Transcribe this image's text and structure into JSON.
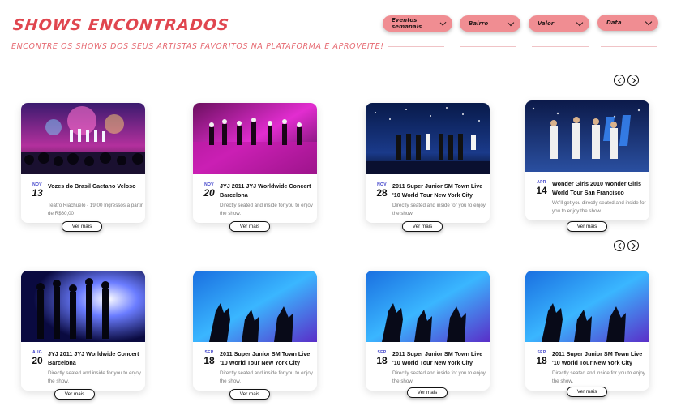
{
  "header": {
    "title": "Shows encontrados",
    "subtitle": "Encontre os shows dos seus artistas favoritos na plataforma e aproveite!"
  },
  "filters": [
    {
      "label": "Eventos semanais",
      "icon": "chevron-down-icon"
    },
    {
      "label": "Bairro",
      "icon": "chevron-down-icon"
    },
    {
      "label": "Valor",
      "icon": "chevron-down-icon"
    },
    {
      "label": "Data",
      "icon": "chevron-down-icon"
    }
  ],
  "carousel_nav": {
    "prev_icon": "chevron-left-icon",
    "next_icon": "chevron-right-icon"
  },
  "cards": [
    {
      "month": "NOV",
      "day": "13",
      "name": "Vozes do Brasil Caetano Veloso",
      "info": "Teatro Riachuelo - 19:00 Ingressos a partir de R$60,00",
      "button": "Ver mais",
      "image": "concert-stage-photo"
    },
    {
      "month": "NOV",
      "day": "20",
      "name": "JYJ 2011 JYJ Worldwide Concert Barcelona",
      "info": "Directly seated and inside for you to enjoy the show.",
      "button": "Ver mais",
      "image": "concert-stage-photo"
    },
    {
      "month": "NOV",
      "day": "28",
      "name": "2011 Super Junior SM Town Live '10 World Tour New York City",
      "info": "Directly seated and inside for you to enjoy the show.",
      "button": "Ver mais",
      "image": "concert-stage-photo"
    },
    {
      "month": "APR",
      "day": "14",
      "name": "Wonder Girls 2010 Wonder Girls World Tour San Francisco",
      "info": "We'll get you directly seated and inside for you to enjoy the show.",
      "button": "Ver mais",
      "image": "concert-stage-photo"
    },
    {
      "month": "AUG",
      "day": "20",
      "name": "JYJ 2011 JYJ Worldwide Concert Barcelona",
      "info": "Directly seated and inside for you to enjoy the show.",
      "button": "Ver mais",
      "image": "dancers-silhouette-photo"
    },
    {
      "month": "SEP",
      "day": "18",
      "name": "2011 Super Junior SM Town Live '10 World Tour New York City",
      "info": "Directly seated and inside for you to enjoy the show.",
      "button": "Ver mais",
      "image": "crowd-hands-photo"
    },
    {
      "month": "SEP",
      "day": "18",
      "name": "2011 Super Junior SM Town Live '10 World Tour New York City",
      "info": "Directly seated and inside for you to enjoy the show.",
      "button": "Ver mais",
      "image": "crowd-hands-photo"
    },
    {
      "month": "SEP",
      "day": "18",
      "name": "2011 Super Junior SM Town Live '10 World Tour New York City",
      "info": "Directly seated and inside for you to enjoy the show.",
      "button": "Ver mais",
      "image": "crowd-hands-photo"
    }
  ],
  "colors": {
    "accent": "#e0464f",
    "filter_bg": "#f08d92",
    "date_month": "#3c3fc9"
  }
}
